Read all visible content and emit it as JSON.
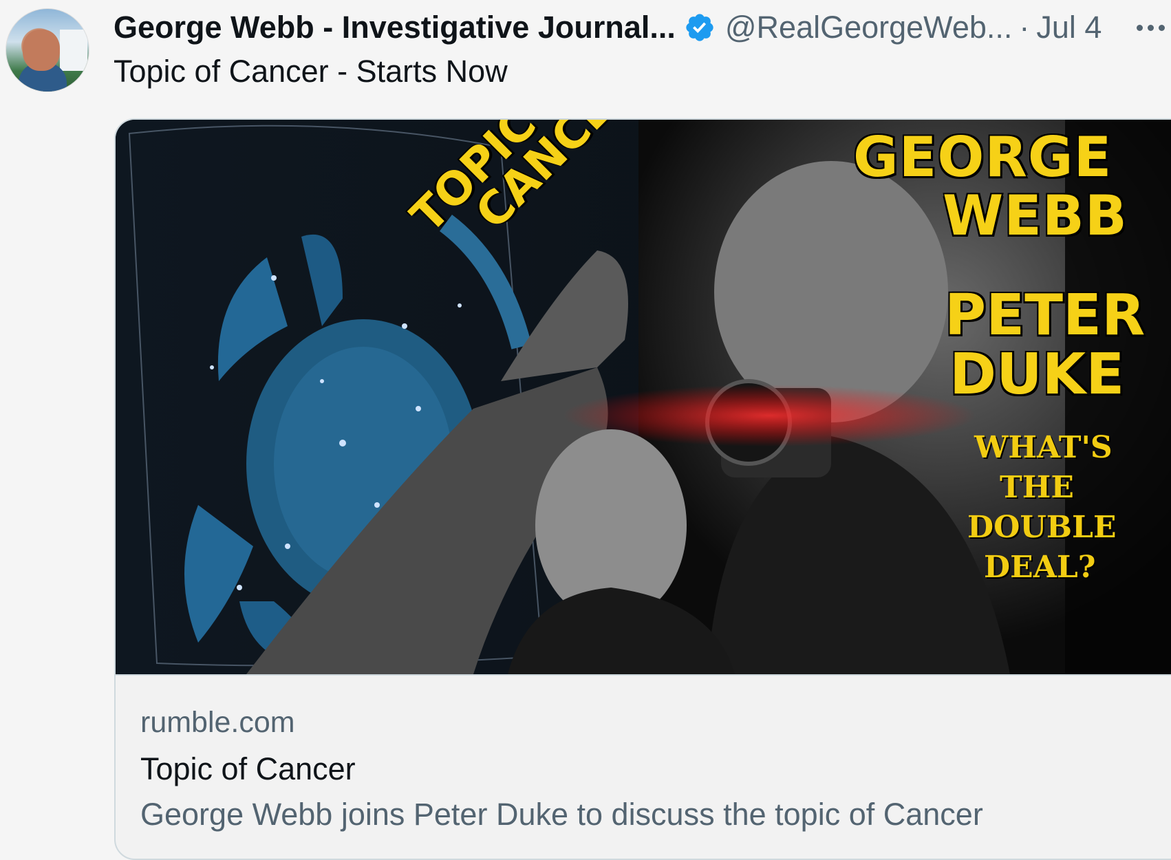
{
  "author": {
    "name": "George Webb - Investigative Journal...",
    "handle": "@RealGeorgeWeb...",
    "separator": "·",
    "date": "Jul 4",
    "verified": true
  },
  "tweet": {
    "text": "Topic of Cancer - Starts Now"
  },
  "card": {
    "thumbnail": {
      "topic_line1": "TOPIC OF",
      "topic_line2": "CANCER",
      "name1_line1": "GEORGE",
      "name1_line2": "WEBB",
      "name2_line1": "PETER",
      "name2_line2": "DUKE",
      "question_lines": [
        "WHAT'S",
        "THE",
        "DOUBLE",
        "DEAL?"
      ]
    },
    "domain": "rumble.com",
    "title": "Topic of Cancer",
    "description": "George Webb joins Peter Duke to discuss the topic of Cancer"
  },
  "colors": {
    "verified_badge": "#1d9bf0",
    "headline_yellow": "#f6d117",
    "secondary_text": "#536471",
    "primary_text": "#0f1419"
  },
  "icons": {
    "verified": "verified-badge-icon",
    "more": "more-options-icon"
  }
}
